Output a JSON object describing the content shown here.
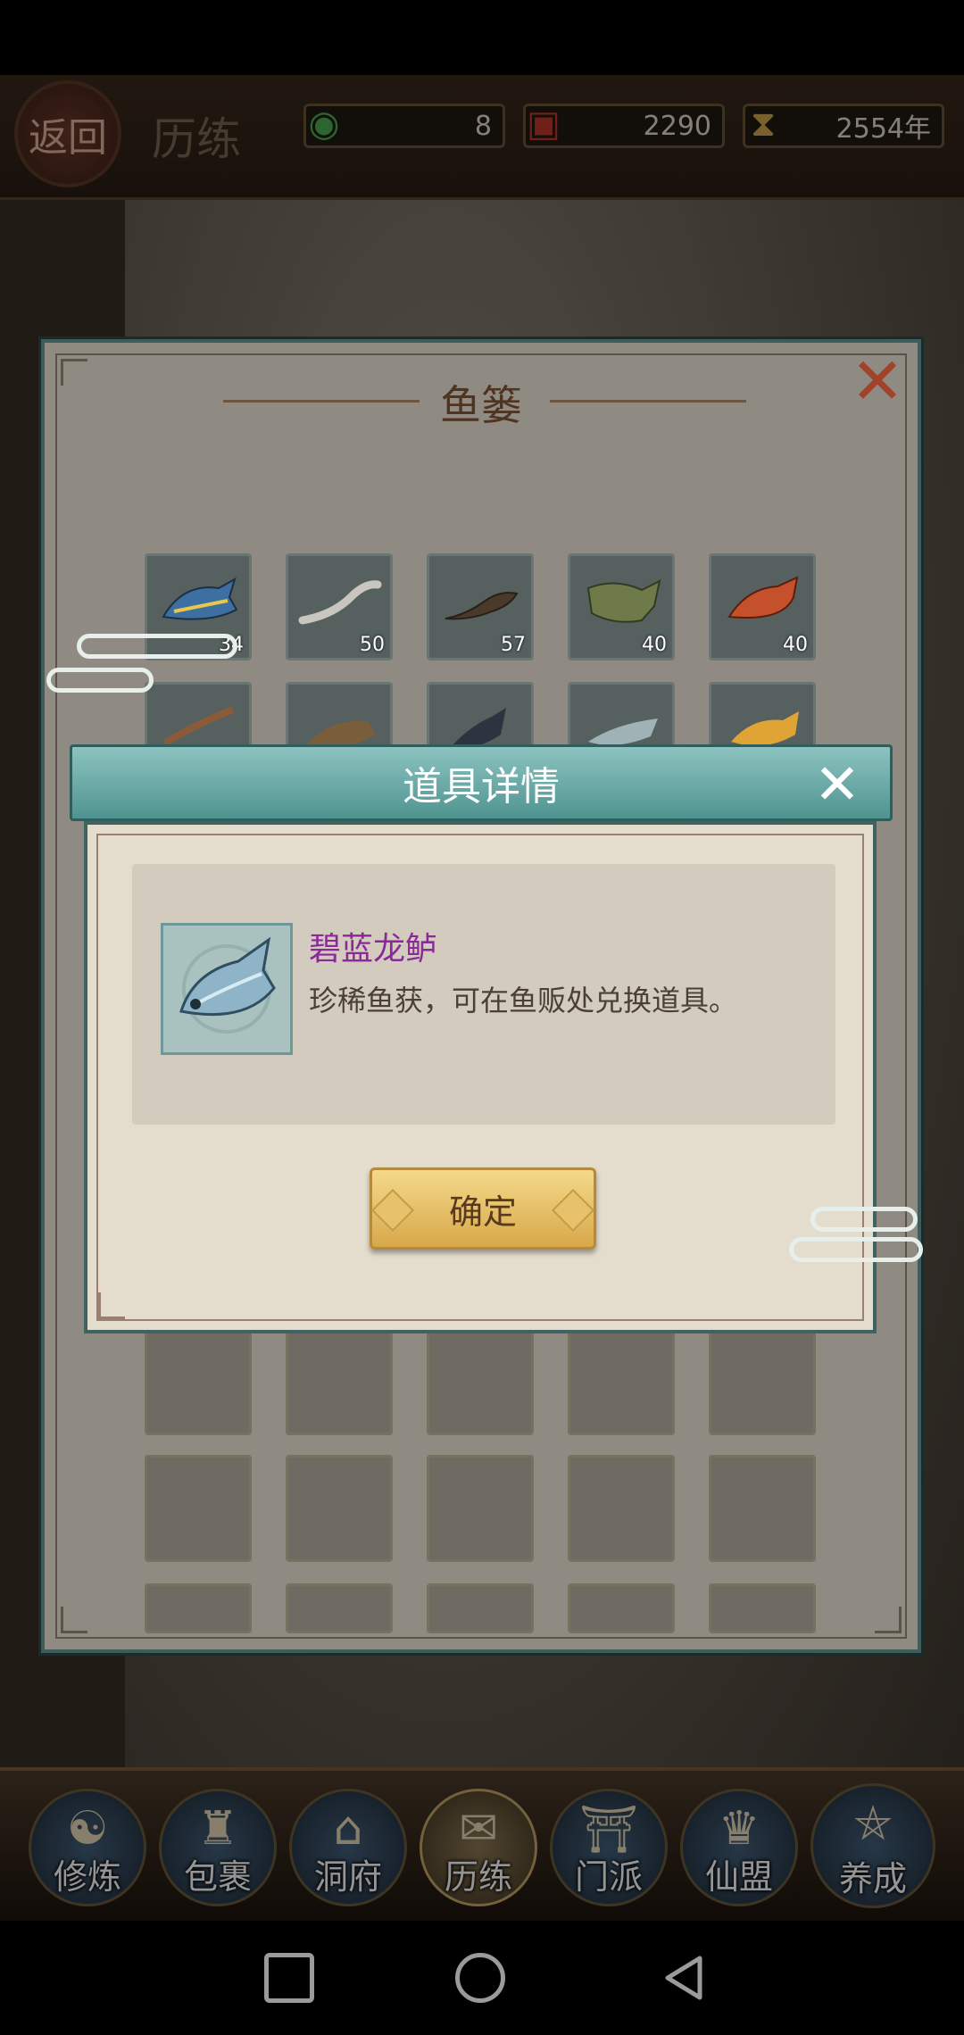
{
  "topbar": {
    "back_label": "返回",
    "screen_title": "历练",
    "resources": [
      {
        "icon": "jade-icon",
        "value": "8"
      },
      {
        "icon": "scroll-icon",
        "value": "2290"
      },
      {
        "icon": "hourglass-icon",
        "value": "2554年"
      }
    ]
  },
  "basket": {
    "title": "鱼篓",
    "close_icon": "close-icon",
    "row1": [
      {
        "icon": "tuna-fish-icon",
        "count": "34"
      },
      {
        "icon": "eel-fish-icon",
        "count": "50"
      },
      {
        "icon": "salamander-icon",
        "count": "57"
      },
      {
        "icon": "bass-fish-icon",
        "count": "40"
      },
      {
        "icon": "red-fish-icon",
        "count": "40"
      }
    ],
    "row2": [
      {
        "icon": "fish-icon"
      },
      {
        "icon": "carp-fish-icon"
      },
      {
        "icon": "striped-fish-icon"
      },
      {
        "icon": "silver-fish-icon"
      },
      {
        "icon": "golden-fish-icon"
      }
    ]
  },
  "detail_dialog": {
    "title": "道具详情",
    "item_name": "碧蓝龙鲈",
    "item_desc": "珍稀鱼获，可在鱼贩处兑换道具。",
    "confirm_label": "确定"
  },
  "bottom_nav": [
    {
      "label": "修炼",
      "icon": "cultivator-icon"
    },
    {
      "label": "包裹",
      "icon": "bag-icon"
    },
    {
      "label": "洞府",
      "icon": "palace-icon"
    },
    {
      "label": "历练",
      "icon": "scroll-map-icon",
      "active": true
    },
    {
      "label": "门派",
      "icon": "gate-icon"
    },
    {
      "label": "仙盟",
      "icon": "alliance-icon"
    },
    {
      "label": "养成",
      "icon": "pentagram-icon"
    }
  ],
  "colors": {
    "dialog_header": "#5fa3a0",
    "item_name": "#8a2a98",
    "confirm_button": "#e8c26a",
    "basket_title": "#4f3421"
  }
}
